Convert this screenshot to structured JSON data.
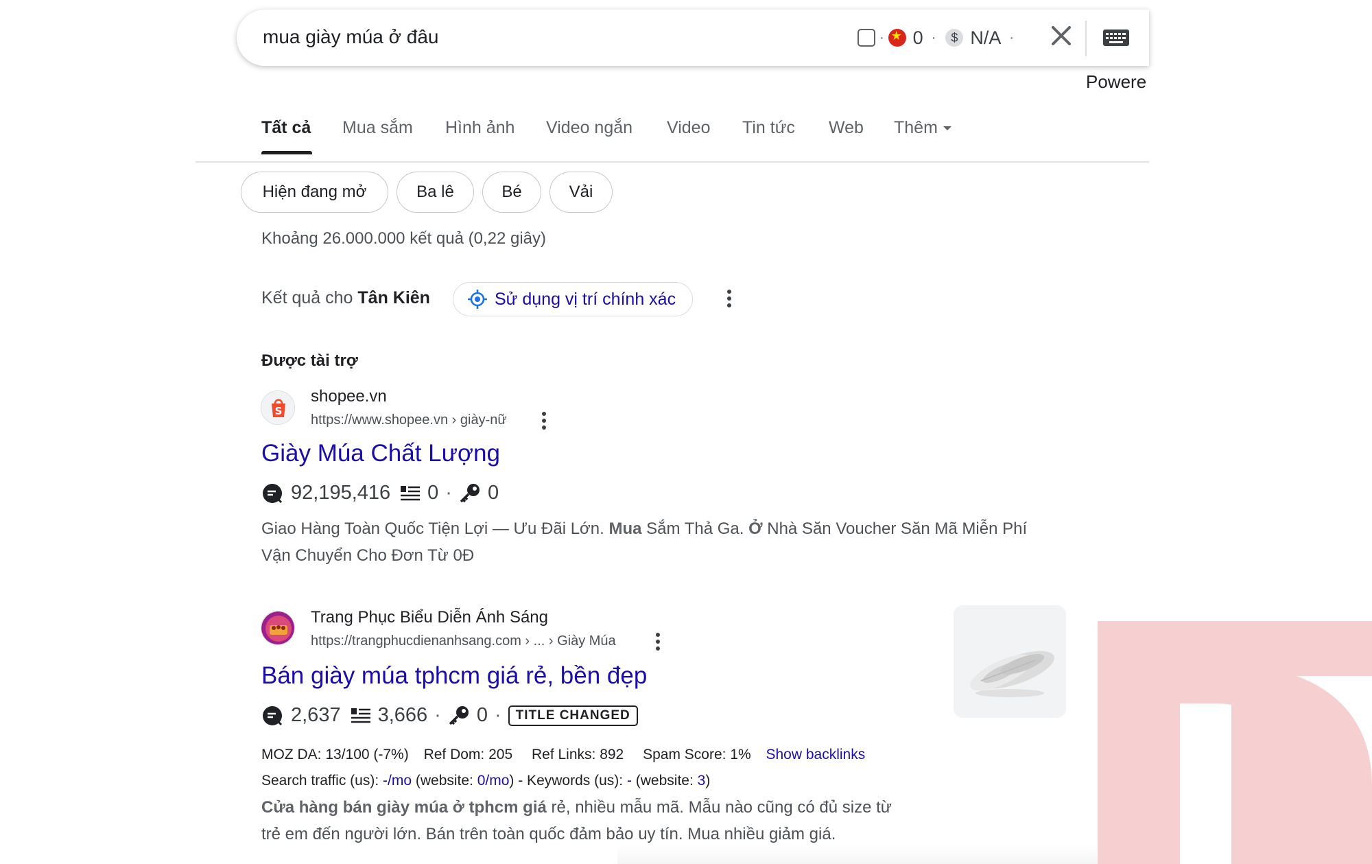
{
  "search": {
    "query": "mua giày múa ở đâu",
    "ext_flag_count": "0",
    "ext_price": "N/A",
    "powered": "Powere"
  },
  "tabs": [
    {
      "label": "Tất cả"
    },
    {
      "label": "Mua sắm"
    },
    {
      "label": "Hình ảnh"
    },
    {
      "label": "Video ngắn"
    },
    {
      "label": "Video"
    },
    {
      "label": "Tin tức"
    },
    {
      "label": "Web"
    },
    {
      "label": "Thêm"
    }
  ],
  "chips": [
    "Hiện đang mở",
    "Ba lê",
    "Bé",
    "Vải"
  ],
  "stats": "Khoảng 26.000.000 kết quả (0,22 giây)",
  "location": {
    "prefix": "Kết quả cho",
    "place": "Tân Kiên",
    "button": "Sử dụng vị trí chính xác"
  },
  "sponsored_label": "Được tài trợ",
  "results": [
    {
      "site": "shopee.vn",
      "url": "https://www.shopee.vn › giày-nữ",
      "title": "Giày Múa Chất Lượng",
      "m1": "92,195,416",
      "m2": "0",
      "m3": "0",
      "snippet_line1_a": "Giao Hàng Toàn Quốc Tiện Lợi — Ưu Đãi Lớn. ",
      "snippet_line1_b": "Mua",
      "snippet_line1_c": " Sắm Thả Ga. ",
      "snippet_line1_d": "Ở",
      "snippet_line1_e": " Nhà Săn Voucher Săn Mã Miễn Phí",
      "snippet_line2": "Vận Chuyển Cho Đơn Từ 0Đ"
    },
    {
      "site": "Trang Phục Biểu Diễn Ánh Sáng",
      "url": "https://trangphucdienanhsang.com › ... › Giày Múa",
      "title": "Bán giày múa tphcm giá rẻ, bền đẹp",
      "m1": "2,637",
      "m2": "3,666",
      "m3": "0",
      "badge": "TITLE CHANGED",
      "seo_line1": {
        "moz": "MOZ DA: 13/100 (-7%)",
        "refdom": "Ref Dom: 205",
        "reflinks": "Ref Links: 892",
        "spam": "Spam Score: 1%",
        "backlinks": "Show backlinks"
      },
      "seo_line2": {
        "p1": "Search traffic (us): ",
        "v1": "-/mo",
        "p2": " (website: ",
        "v2": "0/mo",
        "p3": ") - Keywords (us): ",
        "v3": "-",
        "p4": " (website: ",
        "v4": "3",
        "p5": ")"
      },
      "snippet_bold": "Cửa hàng bán giày múa ở tphcm giá",
      "snippet_line1_rest": " rẻ, nhiều mẫu mã. Mẫu nào cũng có đủ size từ",
      "snippet_line2": "trẻ em đến người lớn. Bán trên toàn quốc đảm bảo uy tín. Mua nhiều giảm giá."
    }
  ],
  "colors": {
    "link": "#1a0dab",
    "watermark": "#f6cfd0"
  }
}
